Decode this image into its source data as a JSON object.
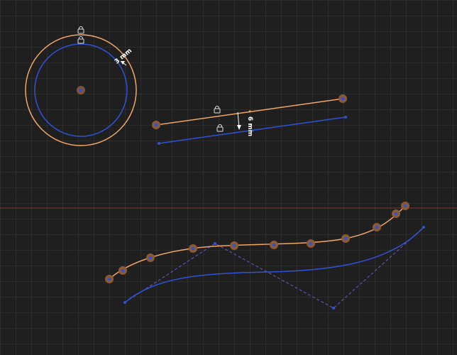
{
  "colors": {
    "background": "#1f1f1f",
    "offset_curve": "#f2a664",
    "source_curve": "#2f53d8",
    "control_handle": "#8b5a34",
    "dimension": "#ffffff",
    "axis_line": "#7a3b2e"
  },
  "circle": {
    "dimension_label": "3 mm",
    "constraint_icons": [
      "lock-icon",
      "lock-icon"
    ]
  },
  "line": {
    "dimension_label": "6 mm",
    "constraint_icons": [
      "lock-icon",
      "lock-icon"
    ]
  },
  "spline": {
    "control_point_count": 11
  }
}
